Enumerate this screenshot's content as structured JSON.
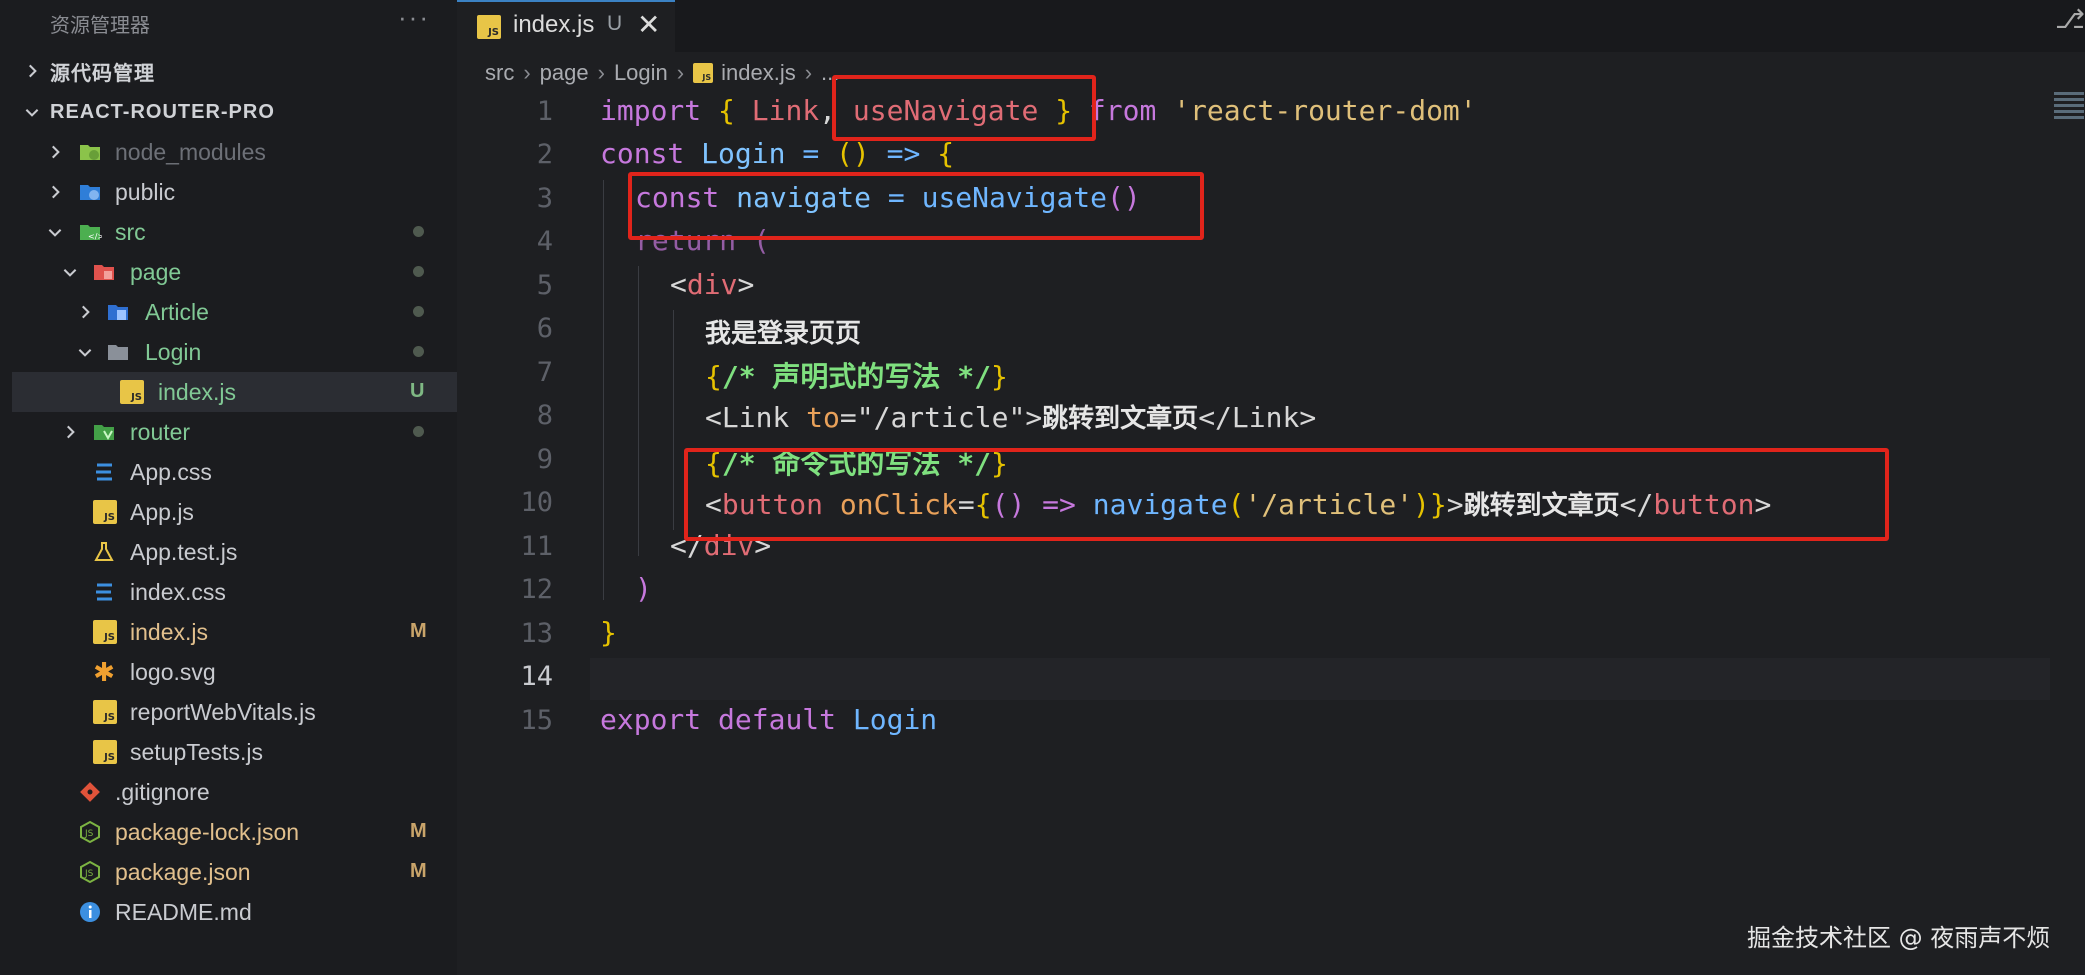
{
  "sidebar": {
    "title": "资源管理器",
    "more": "···",
    "source_control": "源代码管理",
    "project": "REACT-ROUTER-PRO",
    "items": [
      {
        "label": "node_modules",
        "status": ""
      },
      {
        "label": "public",
        "status": ""
      },
      {
        "label": "src",
        "status": ""
      },
      {
        "label": "page",
        "status": ""
      },
      {
        "label": "Article",
        "status": ""
      },
      {
        "label": "Login",
        "status": ""
      },
      {
        "label": "index.js",
        "status": "U"
      },
      {
        "label": "router",
        "status": ""
      },
      {
        "label": "App.css",
        "status": ""
      },
      {
        "label": "App.js",
        "status": ""
      },
      {
        "label": "App.test.js",
        "status": ""
      },
      {
        "label": "index.css",
        "status": ""
      },
      {
        "label": "index.js",
        "status": "M"
      },
      {
        "label": "logo.svg",
        "status": ""
      },
      {
        "label": "reportWebVitals.js",
        "status": ""
      },
      {
        "label": "setupTests.js",
        "status": ""
      },
      {
        "label": ".gitignore",
        "status": ""
      },
      {
        "label": "package-lock.json",
        "status": "M"
      },
      {
        "label": "package.json",
        "status": "M"
      },
      {
        "label": "README.md",
        "status": ""
      }
    ]
  },
  "tab": {
    "label": "index.js",
    "status": "U",
    "close": "✕",
    "badge": "JS"
  },
  "breadcrumb": [
    "src",
    "page",
    "Login",
    "index.js",
    "..."
  ],
  "line_numbers": [
    "1",
    "2",
    "3",
    "4",
    "5",
    "6",
    "7",
    "8",
    "9",
    "10",
    "11",
    "12",
    "13",
    "14",
    "15"
  ],
  "code": {
    "l1": {
      "import": "import",
      "open": "{ ",
      "link": "Link",
      "comma": ",",
      "nav": " useNavigate ",
      "close": "}",
      "from": " from ",
      "str": "'react-router-dom'"
    },
    "l2": {
      "const": "const",
      "name": " Login ",
      "eq": "= ",
      "params": "()",
      "arrow": " => ",
      "brace": "{"
    },
    "l3": {
      "const": "const",
      "name": " navigate ",
      "eq": "= ",
      "fn": "useNavigate",
      "paren": "()"
    },
    "l4": {
      "ret": "return",
      "paren": " ("
    },
    "l5": {
      "open": "<",
      "tag": "div",
      "close": ">"
    },
    "l6": {
      "text": "我是登录页页"
    },
    "l7": {
      "open": "{",
      "cmt": "/* 声明式的写法 */",
      "close": "}"
    },
    "l8": {
      "lt": "<",
      "tag": "Link",
      "attr": " to",
      "eq": "=",
      "str": "\"/article\"",
      "gt": ">",
      "text": "跳转到文章页",
      "end_open": "</",
      "end_tag": "Link",
      "end_gt": ">"
    },
    "l9": {
      "open": "{",
      "cmt": "/* 命令式的写法 */",
      "close": "}"
    },
    "l10": {
      "lt": "<",
      "tag": "button",
      "attr": " onClick",
      "eq": "=",
      "b1": "{",
      "params": "()",
      "arrow": " => ",
      "fn": "navigate",
      "p1": "(",
      "str": "'/article'",
      "p2": ")",
      "b2": "}",
      "gt": ">",
      "text": "跳转到文章页",
      "end_open": "</",
      "end_tag": "button",
      "end_gt": ">"
    },
    "l11": {
      "open": "</",
      "tag": "div",
      "close": ">"
    },
    "l12": {
      "paren": ")"
    },
    "l13": {
      "brace": "}"
    },
    "l15": {
      "export": "export",
      "default": " default",
      "name": " Login"
    }
  },
  "watermark": "掘金技术社区 @ 夜雨声不烦",
  "colors": {
    "highlight": "#e1241b",
    "js_badge": "#e8c547"
  }
}
